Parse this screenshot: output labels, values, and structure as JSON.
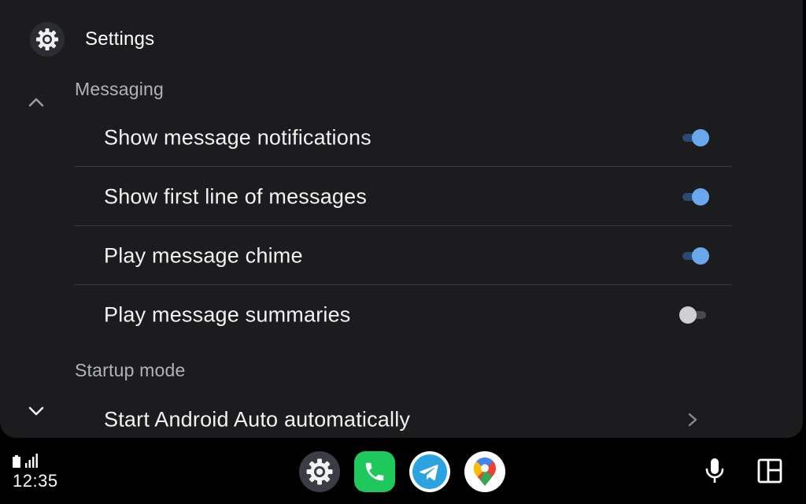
{
  "header": {
    "app_icon": "gear-icon",
    "title": "Settings"
  },
  "nav": {
    "scroll_up_icon": "chevron-up-icon",
    "scroll_down_icon": "chevron-down-icon"
  },
  "sections": {
    "messaging": {
      "title": "Messaging",
      "items": [
        {
          "label": "Show message notifications",
          "toggle": true
        },
        {
          "label": "Show first line of messages",
          "toggle": true
        },
        {
          "label": "Play message chime",
          "toggle": true
        },
        {
          "label": "Play message summaries",
          "toggle": false
        }
      ]
    },
    "startup": {
      "title": "Startup mode",
      "items": [
        {
          "label": "Start Android Auto automatically",
          "icon": "chevron-right-icon"
        }
      ]
    }
  },
  "dock": {
    "time": "12:35",
    "status_icons": [
      "battery-icon",
      "signal-icon"
    ],
    "apps": [
      "settings-app-icon",
      "phone-app-icon",
      "telegram-app-icon",
      "maps-app-icon"
    ],
    "buttons": [
      "microphone-icon",
      "dashboard-layout-icon"
    ]
  },
  "colors": {
    "panel_bg": "#1c1c1e",
    "toggle_on": "#6aa8ee",
    "toggle_off": "#cfcfd2",
    "section_text": "#b0b3b8",
    "phone_green": "#1ec85b",
    "telegram_blue": "#2aa3e0"
  }
}
